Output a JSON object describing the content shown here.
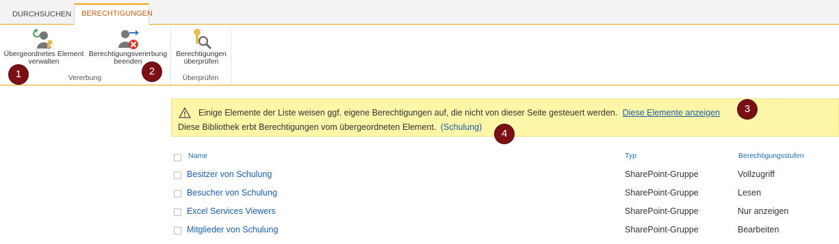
{
  "ribbon": {
    "tabs": [
      {
        "label": "DURCHSUCHEN"
      },
      {
        "label": "BERECHTIGUNGEN"
      }
    ],
    "buttons": {
      "manage_parent": {
        "line1": "Übergeordnetes Element",
        "line2": "verwalten",
        "icon": "manage-parent-icon"
      },
      "stop_inheritance": {
        "line1": "Berechtigungsvererbung",
        "line2": "beenden",
        "icon": "stop-inheritance-icon"
      },
      "check_permissions": {
        "line1": "Berechtigungen",
        "line2": "überprüfen",
        "icon": "check-permissions-icon"
      }
    },
    "groups": {
      "inheritance": "Vererbung",
      "check": "Überprüfen"
    }
  },
  "badges": [
    "1",
    "2",
    "3",
    "4"
  ],
  "notice": {
    "line1_text": "Einige Elemente der Liste weisen ggf. eigene Berechtigungen auf, die nicht von dieser Seite gesteuert werden.",
    "line1_link": "Diese Elemente anzeigen",
    "line2_text": "Diese Bibliothek erbt Berechtigungen vom übergeordneten Element.",
    "line2_link": "(Schulung)"
  },
  "table": {
    "headers": {
      "name": "Name",
      "type": "Typ",
      "levels": "Berechtigungsstufen"
    },
    "rows": [
      {
        "name": "Besitzer von Schulung",
        "type": "SharePoint-Gruppe",
        "level": "Vollzugriff"
      },
      {
        "name": "Besucher von Schulung",
        "type": "SharePoint-Gruppe",
        "level": "Lesen"
      },
      {
        "name": "Excel Services Viewers",
        "type": "SharePoint-Gruppe",
        "level": "Nur anzeigen"
      },
      {
        "name": "Mitglieder von Schulung",
        "type": "SharePoint-Gruppe",
        "level": "Bearbeiten"
      }
    ]
  },
  "colors": {
    "accent": "#f0a30a",
    "link": "#1a5fa8",
    "badge": "#7a0f14",
    "notice_bg": "#fdf6a8"
  }
}
